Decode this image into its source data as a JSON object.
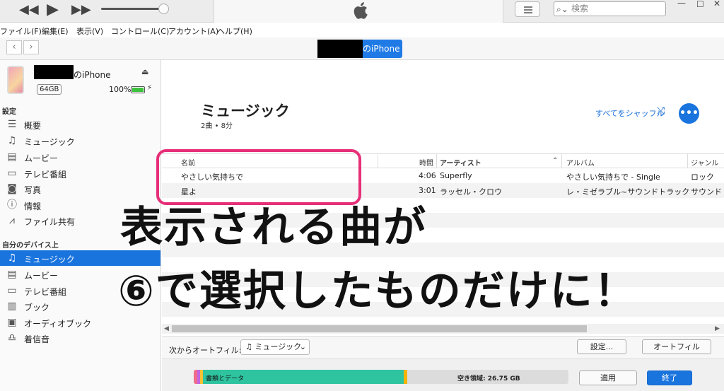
{
  "toolbar": {
    "rewind_icon": "rewind-icon",
    "play_icon": "play-icon",
    "forward_icon": "fast-forward-icon",
    "search_placeholder": "検索"
  },
  "menubar": {
    "items": [
      "ファイル(F)",
      "編集(E)",
      "表示(V)",
      "コントロール(C)",
      "アカウント(A)",
      "ヘルプ(H)"
    ]
  },
  "navbar": {
    "device_label": "のiPhone"
  },
  "sidebar": {
    "device_name": "のiPhone",
    "capacity": "64GB",
    "battery": "100%",
    "battery_level": 1.0,
    "settings_head": "設定",
    "settings_items": [
      {
        "label": "概要",
        "icon": "summary-icon"
      },
      {
        "label": "ミュージック",
        "icon": "music-note-icon"
      },
      {
        "label": "ムービー",
        "icon": "film-icon"
      },
      {
        "label": "テレビ番組",
        "icon": "tv-icon"
      },
      {
        "label": "写真",
        "icon": "camera-icon"
      },
      {
        "label": "情報",
        "icon": "info-icon"
      },
      {
        "label": "ファイル共有",
        "icon": "app-store-icon"
      }
    ],
    "device_head": "自分のデバイス上",
    "device_items": [
      {
        "label": "ミュージック",
        "icon": "music-note-icon",
        "selected": true
      },
      {
        "label": "ムービー",
        "icon": "film-icon"
      },
      {
        "label": "テレビ番組",
        "icon": "tv-icon"
      },
      {
        "label": "ブック",
        "icon": "book-icon"
      },
      {
        "label": "オーディオブック",
        "icon": "audiobook-icon"
      },
      {
        "label": "着信音",
        "icon": "bell-icon"
      }
    ]
  },
  "main": {
    "title": "ミュージック",
    "subtitle": "2曲 • 8分",
    "shuffle_label": "すべてをシャッフル",
    "more_label": "•••",
    "columns": {
      "name": "名前",
      "time": "時間",
      "artist": "アーティスト",
      "album": "アルバム",
      "genre": "ジャンル"
    },
    "rows": [
      {
        "name": "やさしい気持ちで",
        "time": "4:06",
        "artist": "Superfly",
        "album": "やさしい気持ちで - Single",
        "genre": "ロック"
      },
      {
        "name": "星よ",
        "time": "3:01",
        "artist": "ラッセル・クロウ",
        "album": "レ・ミゼラブル~サウンドトラック",
        "genre": "サウンド"
      }
    ],
    "autofill_label": "次からオートフィル:",
    "autofill_value": "ミュージック",
    "settings_button": "設定...",
    "autofill_button": "オートフィル",
    "storage": {
      "docs_label": "書類とデータ",
      "free_label": "空き領域: 26.75 GB"
    },
    "apply_button": "適用",
    "done_button": "終了"
  },
  "overlay": {
    "line1": "表示される曲が",
    "line2": "⑥で選択したものだけに！"
  }
}
